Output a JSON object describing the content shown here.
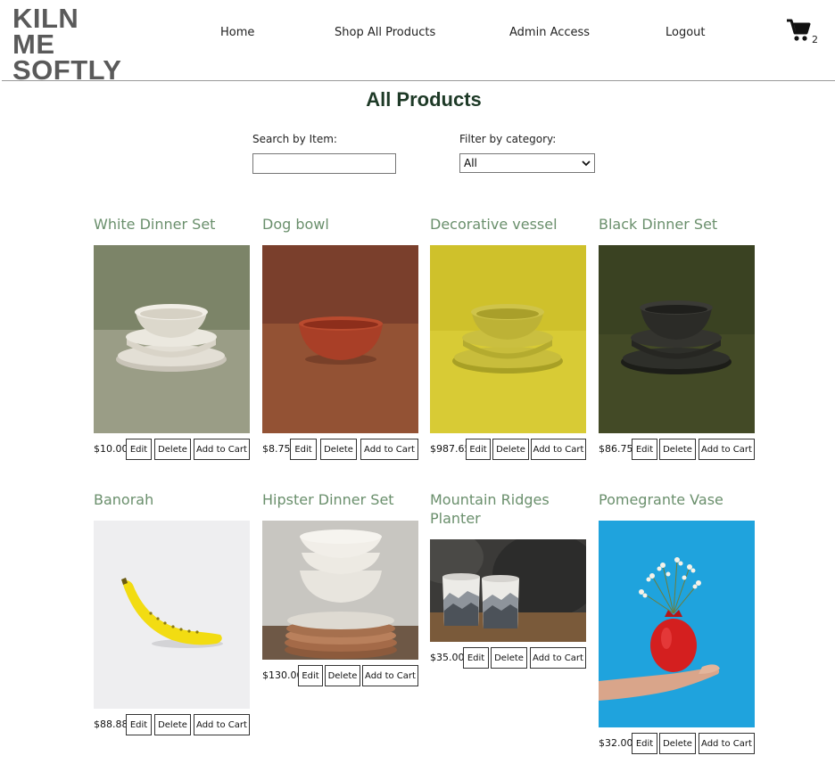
{
  "header": {
    "logo_line1": "KILN ME",
    "logo_line2": "SOFTLY",
    "nav": {
      "home": "Home",
      "shop": "Shop All Products",
      "admin": "Admin Access",
      "logout": "Logout"
    },
    "cart_count": "2"
  },
  "page_title": "All Products",
  "search": {
    "label": "Search by Item:",
    "value": "",
    "placeholder": ""
  },
  "filter": {
    "label": "Filter by category:",
    "selected": "All"
  },
  "buttons": {
    "edit": "Edit",
    "delete": "Delete",
    "add": "Add to Cart"
  },
  "products": [
    {
      "name": "White Dinner Set",
      "price": "$10.00",
      "image": "white-bowl-stack"
    },
    {
      "name": "Dog bowl",
      "price": "$8.75",
      "image": "terracotta-bowl"
    },
    {
      "name": "Decorative vessel",
      "price": "$987.65",
      "image": "yellow-bowl-stack"
    },
    {
      "name": "Black Dinner Set",
      "price": "$86.75",
      "image": "black-bowl-stack"
    },
    {
      "name": "Banorah",
      "price": "$88.88",
      "image": "banana-ceramic"
    },
    {
      "name": "Hipster Dinner Set",
      "price": "$130.00",
      "image": "speckled-bowls-plates"
    },
    {
      "name": "Mountain Ridges Planter",
      "price": "$35.00",
      "image": "mountain-planters"
    },
    {
      "name": "Pomegrante Vase",
      "price": "$32.00",
      "image": "pomegranate-vase"
    }
  ],
  "colors": {
    "title_green": "#1e3a27",
    "product_name": "#6a8f6c",
    "logo_gray": "#5a5a5a"
  }
}
